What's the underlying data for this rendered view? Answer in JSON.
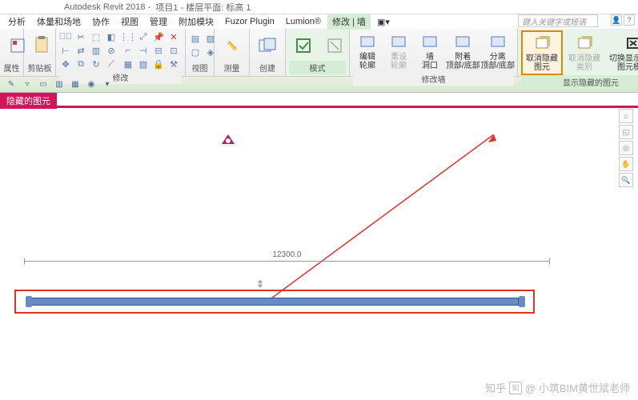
{
  "app_title": "Autodesk Revit 2018 -",
  "doc_title": "项目1 - 楼层平面: 标高 1",
  "search_placeholder": "键入关键字或短语",
  "menu": [
    "分析",
    "体量和场地",
    "协作",
    "视图",
    "管理",
    "附加模块",
    "Fuzor Plugin",
    "Lumion®",
    "修改 | 墙"
  ],
  "active_menu": 8,
  "panels": {
    "p1": {
      "label": "属性"
    },
    "p2": {
      "label": "剪贴板"
    },
    "p3": {
      "label": "修改"
    },
    "p4": {
      "label": "视图"
    },
    "p5": {
      "label": "测量"
    },
    "p6": {
      "label": "创建"
    },
    "p7": {
      "label": "模式",
      "green": true
    },
    "p8": {
      "label": "修改墙",
      "items": [
        {
          "l1": "编辑",
          "l2": "轮廓"
        },
        {
          "l1": "重设",
          "l2": "轮廓",
          "disabled": true
        },
        {
          "l1": "墙",
          "l2": "洞口"
        },
        {
          "l1": "附着",
          "l2": "顶部/底部"
        },
        {
          "l1": "分离",
          "l2": "顶部/底部"
        }
      ]
    },
    "p9": {
      "label": "显示隐藏的图元",
      "green": true,
      "items": [
        {
          "l1": "取消隐藏",
          "l2": "图元",
          "hl": true
        },
        {
          "l1": "取消隐藏",
          "l2": "类别",
          "disabled": true
        },
        {
          "l1": "切换显示隐藏",
          "l2": "图元模式"
        }
      ]
    }
  },
  "view_tab": "隐藏的图元",
  "dimension": "12300.0",
  "watermark": "@ 小筑BIM黄世斌老师",
  "wm_brand": "知乎"
}
